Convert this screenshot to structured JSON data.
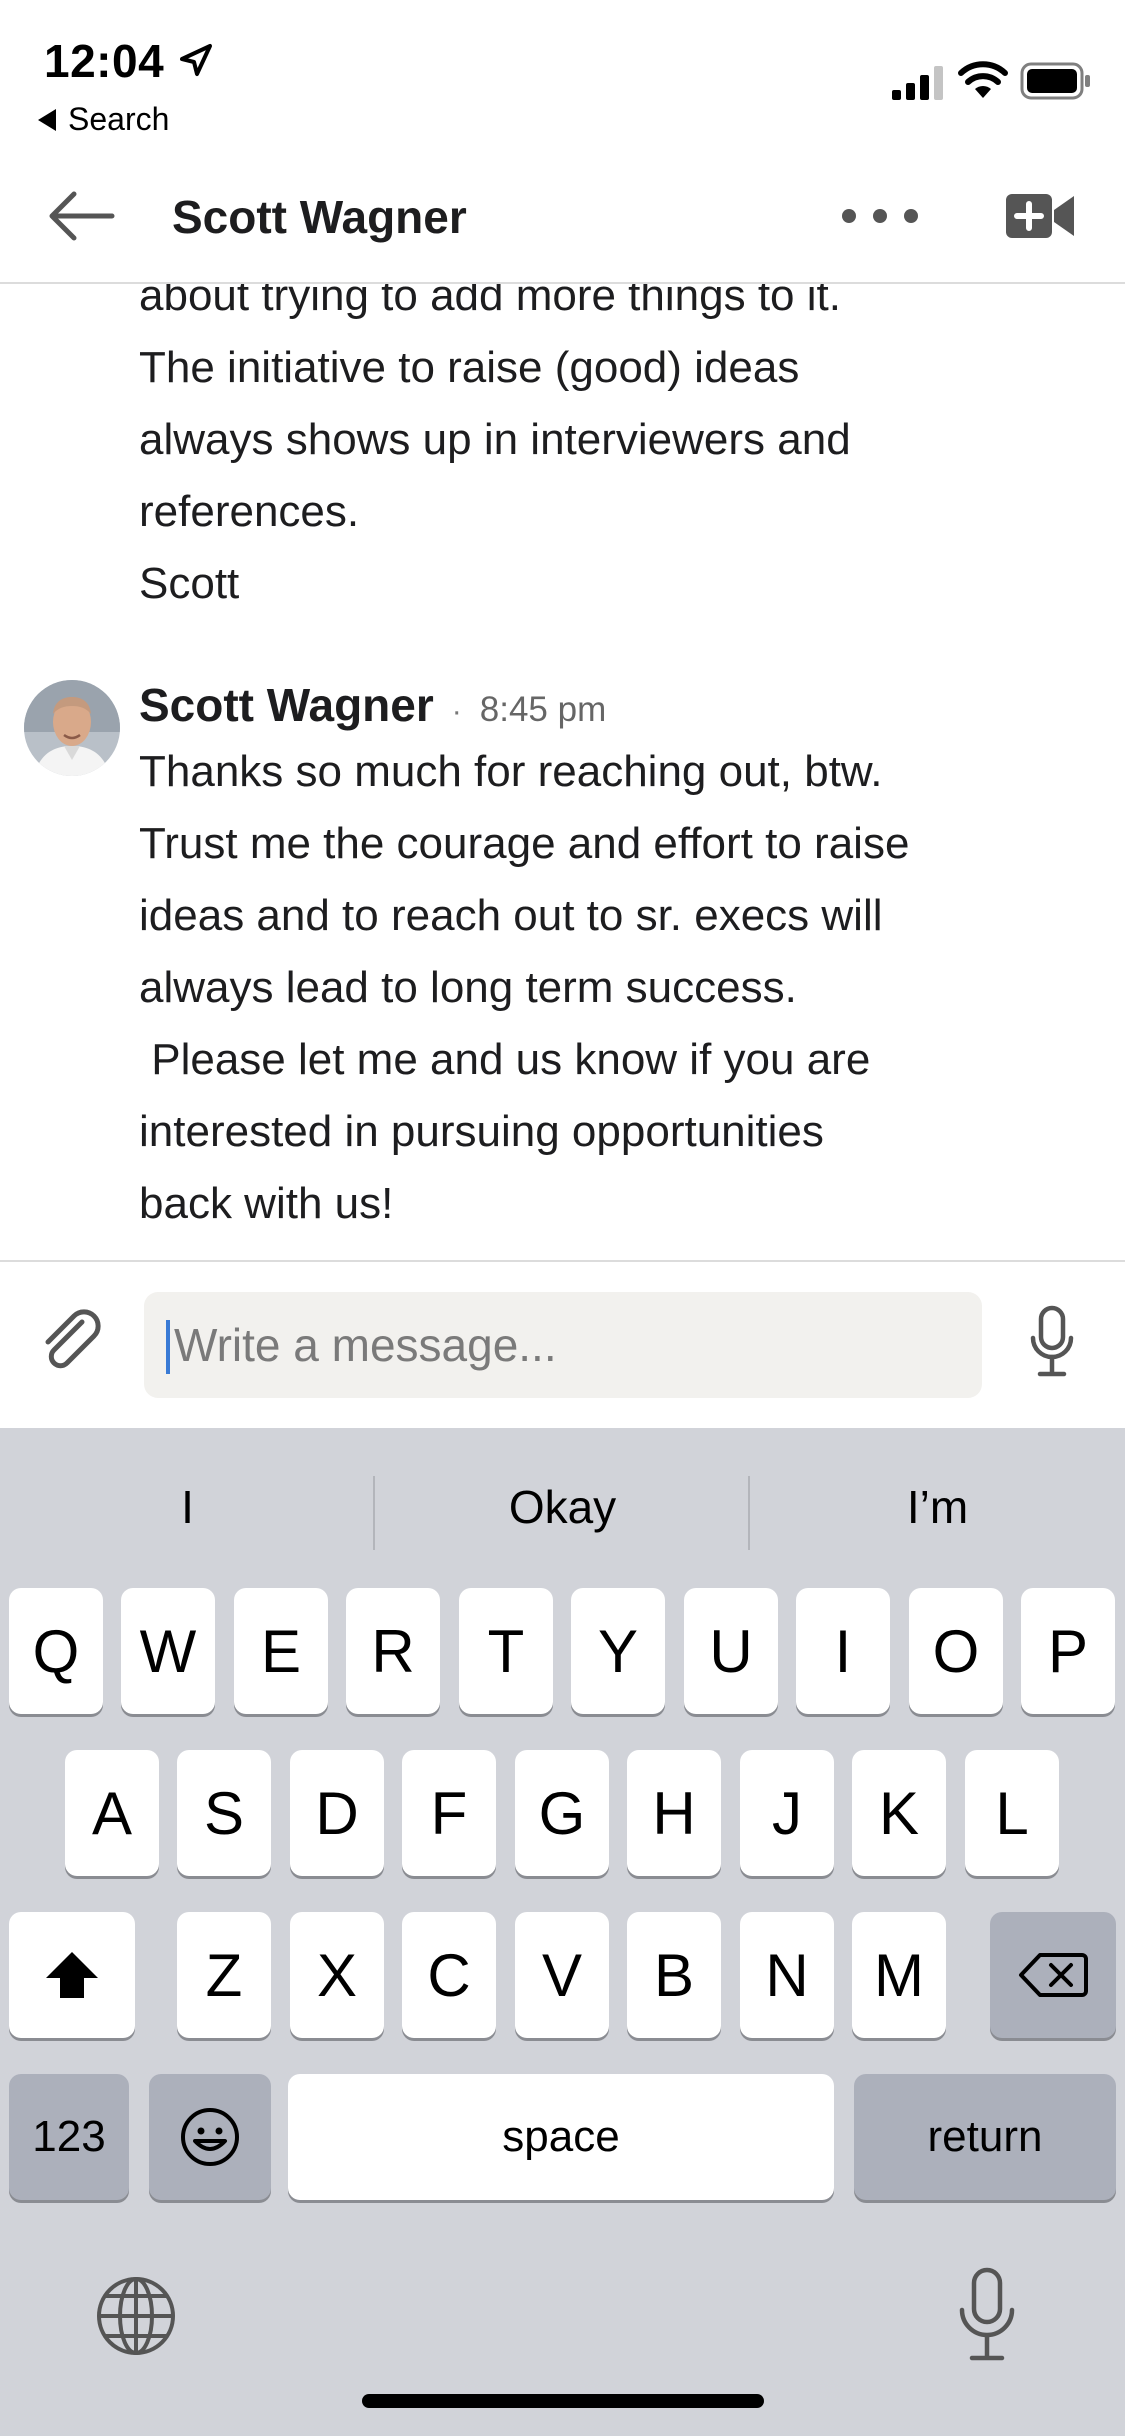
{
  "status_bar": {
    "time": "12:04",
    "back_app": "Search"
  },
  "header": {
    "title": "Scott Wagner"
  },
  "messages": {
    "previous_lines": [
      "about trying to add more things to it.",
      "The initiative to raise (good) ideas",
      "always shows up in interviewers and",
      "references.",
      "Scott"
    ],
    "latest": {
      "sender": "Scott Wagner",
      "separator": "·",
      "time": "8:45 pm",
      "lines": [
        "Thanks so much for reaching out, btw.",
        "Trust me the courage and effort to raise",
        "ideas and to reach out to sr. execs will",
        "always lead to long term success.",
        " Please let me and us know if you are",
        "interested in pursuing opportunities",
        "back with us!"
      ]
    }
  },
  "composer": {
    "placeholder": "Write a message...",
    "value": ""
  },
  "keyboard": {
    "suggestions": [
      "I",
      "Okay",
      "I’m"
    ],
    "row1": [
      "Q",
      "W",
      "E",
      "R",
      "T",
      "Y",
      "U",
      "I",
      "O",
      "P"
    ],
    "row2": [
      "A",
      "S",
      "D",
      "F",
      "G",
      "H",
      "J",
      "K",
      "L"
    ],
    "row3": [
      "Z",
      "X",
      "C",
      "V",
      "B",
      "N",
      "M"
    ],
    "numbers_key": "123",
    "space_key": "space",
    "return_key": "return"
  },
  "icons": {
    "location": "location-arrow-icon",
    "signal": "cellular-signal-icon",
    "wifi": "wifi-icon",
    "battery": "battery-icon",
    "back": "arrow-left-icon",
    "more": "more-horizontal-icon",
    "video": "video-call-icon",
    "attach": "paperclip-icon",
    "mic": "microphone-icon",
    "emoji": "emoji-icon",
    "shift": "shift-icon",
    "delete": "delete-icon",
    "globe": "globe-icon",
    "dictation": "dictation-icon"
  },
  "colors": {
    "keyboard_bg": "#d1d3d9",
    "input_bg": "#f2f1ee",
    "caret": "#3a7bd5"
  }
}
